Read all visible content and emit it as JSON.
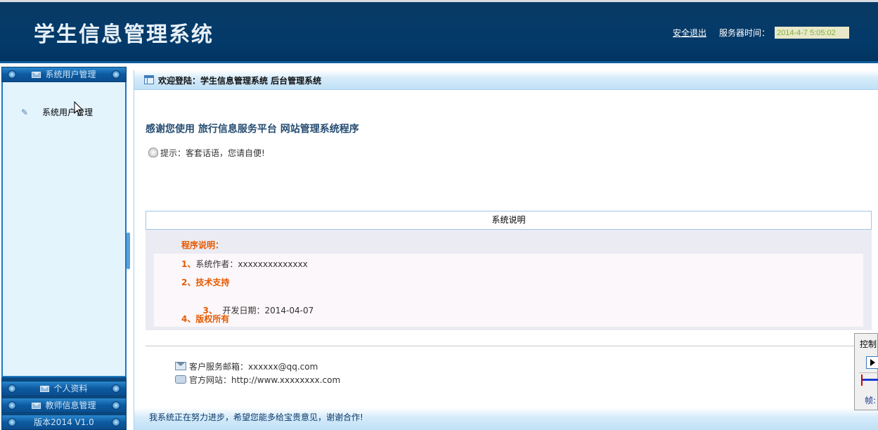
{
  "header": {
    "title": "学生信息管理系统",
    "logout": "安全退出",
    "time_label": "服务器时间：",
    "server_time": "2014-4-7 5:05:02"
  },
  "sidebar": {
    "sections": [
      {
        "label": "系统用户管理"
      },
      {
        "label": "个人资料"
      },
      {
        "label": "教师信息管理"
      },
      {
        "label": "版本2014 V1.0"
      }
    ],
    "items": [
      {
        "label": "系统用户管理"
      }
    ]
  },
  "main": {
    "title": "欢迎登陆：学生信息管理系统 后台管理系统",
    "welcome": "感谢您使用 旅行信息服务平台 网站管理系统程序",
    "tip": "提示：客套话语，您请自便!",
    "table": {
      "header": "系统说明",
      "desc_label": "程序说明：",
      "rows": [
        {
          "num": "1、",
          "text": "系统作者：xxxxxxxxxxxxxx"
        },
        {
          "num": "2、",
          "text": "技术支持"
        },
        {
          "num": "3、",
          "text": "  开发日期：2014-04-07"
        },
        {
          "num": "4、",
          "text": "版权所有"
        }
      ]
    },
    "contact": {
      "email": "客户服务邮箱：xxxxxx@qq.com",
      "website": "官方网站：http://www.xxxxxxxx.com"
    },
    "footer": "我系统正在努力进步，希望您能多给宝贵意见，谢谢合作!"
  },
  "control_widget": {
    "label": "控制",
    "frame_label": "帧:"
  },
  "colors": {
    "header_bg": "#033a6a",
    "accent_orange": "#e65a00",
    "sidebar_bar": "#0d5aa0",
    "panel_bg": "#e3f4fd"
  }
}
